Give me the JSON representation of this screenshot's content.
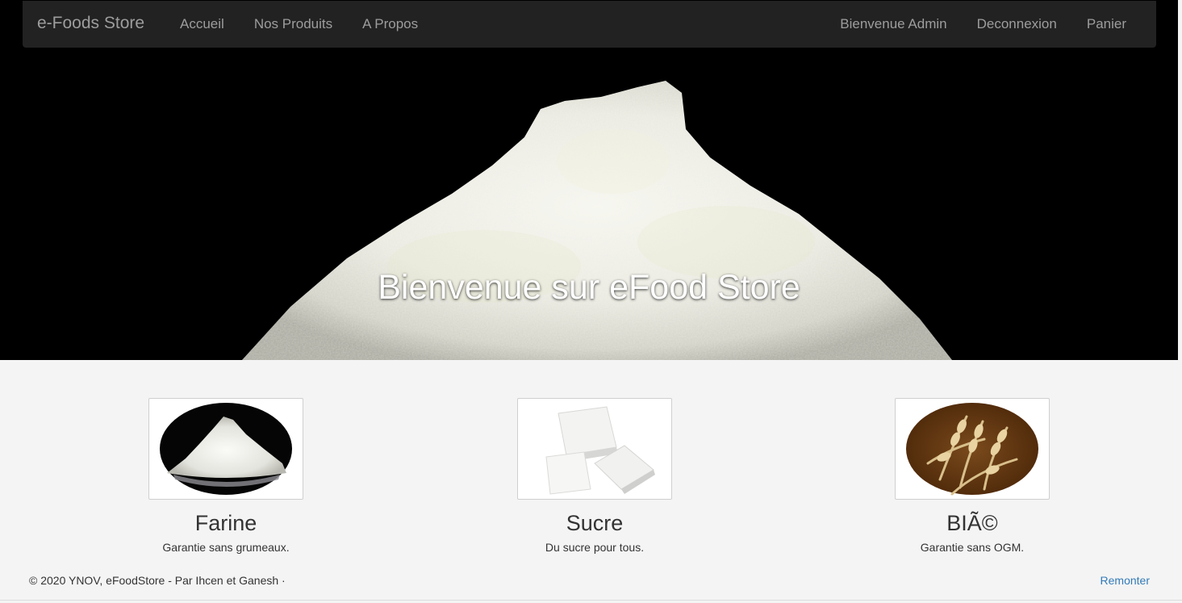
{
  "navbar": {
    "brand": "e-Foods Store",
    "left_links": [
      "Accueil",
      "Nos Produits",
      "A Propos"
    ],
    "right_links": [
      "Bienvenue Admin",
      "Deconnexion",
      "Panier"
    ]
  },
  "hero": {
    "title": "Bienvenue sur eFood Store"
  },
  "features": [
    {
      "title": "Farine",
      "description": "Garantie sans grumeaux.",
      "image": "flour-pile-image"
    },
    {
      "title": "Sucre",
      "description": "Du sucre pour tous.",
      "image": "sugar-cubes-image"
    },
    {
      "title": "BIÃ©",
      "description": "Garantie sans OGM.",
      "image": "wheat-ears-image"
    }
  ],
  "footer": {
    "copyright": "© 2020 YNOV, eFoodStore - Par Ihcen et Ganesh ·",
    "back_to_top": "Remonter"
  },
  "colors": {
    "navbar_bg": "#222222",
    "nav_text": "#9d9d9d",
    "page_bg": "#f4f4f4",
    "link": "#337ab7"
  }
}
